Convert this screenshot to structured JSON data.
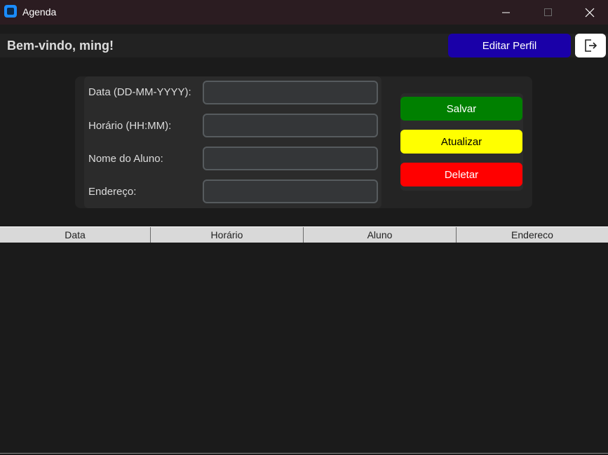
{
  "window": {
    "title": "Agenda",
    "icon": "app-window-icon"
  },
  "header": {
    "welcome_text": "Bem-vindo, ming!",
    "edit_profile_label": "Editar Perfil",
    "logout_icon": "logout-icon"
  },
  "form": {
    "date_label": "Data (DD-MM-YYYY):",
    "date_value": "",
    "time_label": "Horário (HH:MM):",
    "time_value": "",
    "student_label": "Nome do Aluno:",
    "student_value": "",
    "address_label": "Endereço:",
    "address_value": ""
  },
  "actions": {
    "save_label": "Salvar",
    "update_label": "Atualizar",
    "delete_label": "Deletar"
  },
  "table": {
    "columns": [
      "Data",
      "Horário",
      "Aluno",
      "Endereco"
    ],
    "rows": []
  },
  "colors": {
    "edit_button": "#1a00a8",
    "save_button": "#008000",
    "update_button": "#ffff00",
    "delete_button": "#ff0000",
    "background": "#1b1b1b"
  }
}
